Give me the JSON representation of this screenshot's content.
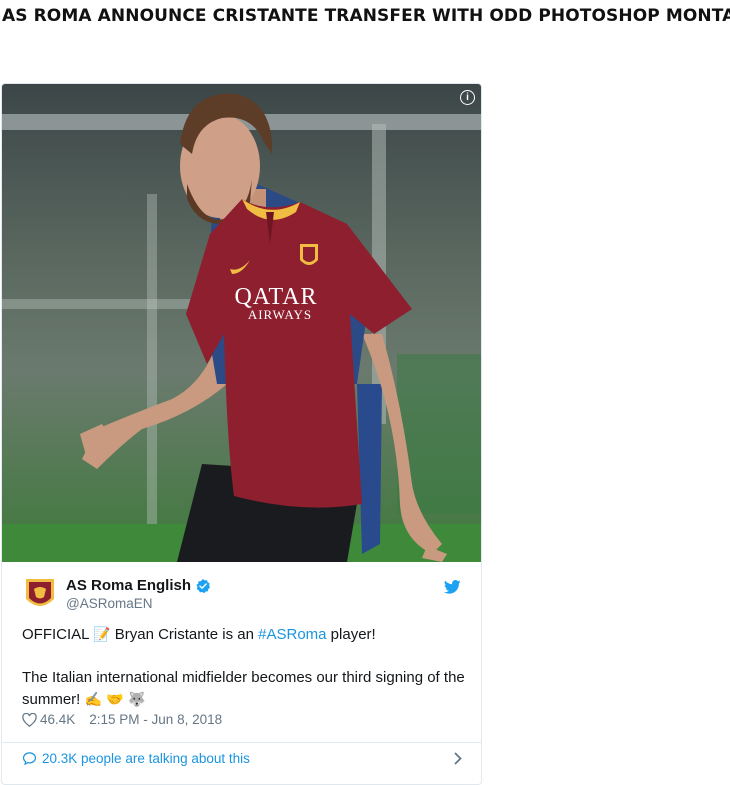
{
  "article": {
    "headline": "AS ROMA ANNOUNCE CRISTANTE TRANSFER WITH ODD PHOTOSHOP MONTAGE"
  },
  "tweet": {
    "image": {
      "shirt_sponsor_line1": "QATAR",
      "shirt_sponsor_line2": "AIRWAYS",
      "info_icon": "info-icon"
    },
    "author": {
      "display_name": "AS Roma English",
      "handle": "@ASRomaEN",
      "verified": true
    },
    "text": {
      "official": "OFFICIAL",
      "before_hashtag": "Bryan Cristante is an ",
      "hashtag": "#ASRoma",
      "after_hashtag": " player!",
      "paragraph2": "The Italian international midfielder becomes our third signing of the summer!",
      "emojis": "✍️ 🤝 🐺"
    },
    "likes": "46.4K",
    "timestamp": "2:15 PM - Jun 8, 2018",
    "talking": "20.3K people are talking about this"
  },
  "colors": {
    "twitter_blue": "#1da1f2",
    "link_blue": "#1b95e0",
    "roma_red": "#8e1f2f",
    "roma_gold": "#f0bc42"
  }
}
